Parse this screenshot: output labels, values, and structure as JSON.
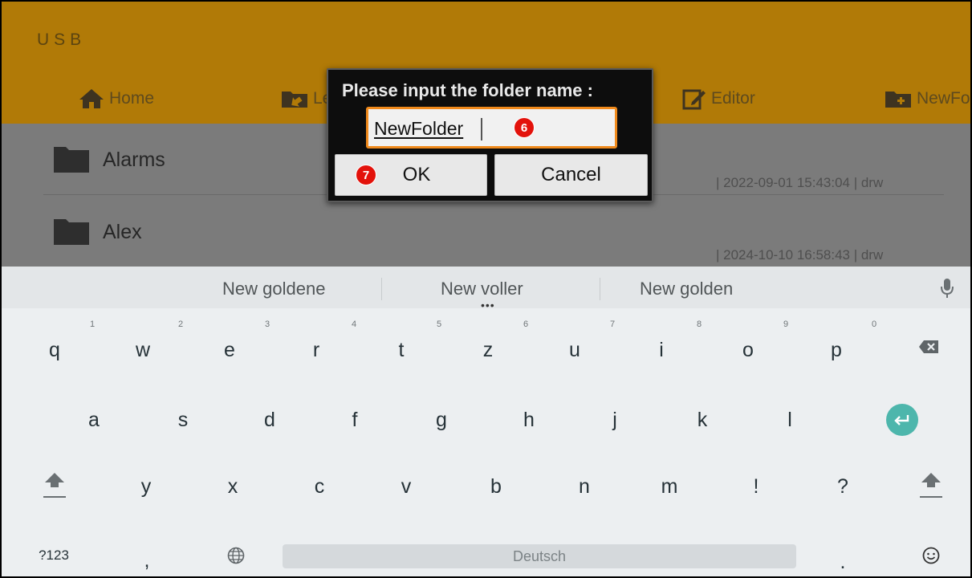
{
  "app": {
    "title": "USB",
    "toolbar": [
      {
        "label": "Home",
        "icon": "home-icon"
      },
      {
        "label": "Le",
        "icon": "folder-up-icon"
      },
      {
        "label": "Editor",
        "icon": "edit-icon"
      },
      {
        "label": "NewFo",
        "icon": "new-folder-icon"
      }
    ],
    "files": [
      {
        "name": "Alarms",
        "meta": "| 2022-09-01 15:43:04 | drw"
      },
      {
        "name": "Alex",
        "meta": "| 2024-10-10 16:58:43 | drw"
      }
    ],
    "colors": {
      "appbar": "#b17a07",
      "accent_orange": "#f08a1c",
      "enter": "#4db6ac",
      "badge": "#e3120b"
    }
  },
  "dialog": {
    "title": "Please input the folder name :",
    "input_value": "NewFolder",
    "ok_label": "OK",
    "cancel_label": "Cancel",
    "badge_input": "6",
    "badge_ok": "7"
  },
  "keyboard": {
    "suggestions": [
      "New goldene",
      "New voller",
      "New golden"
    ],
    "more_indicator": "•••",
    "row1": [
      {
        "key": "q",
        "hint": "1"
      },
      {
        "key": "w",
        "hint": "2"
      },
      {
        "key": "e",
        "hint": "3"
      },
      {
        "key": "r",
        "hint": "4"
      },
      {
        "key": "t",
        "hint": "5"
      },
      {
        "key": "z",
        "hint": "6"
      },
      {
        "key": "u",
        "hint": "7"
      },
      {
        "key": "i",
        "hint": "8"
      },
      {
        "key": "o",
        "hint": "9"
      },
      {
        "key": "p",
        "hint": "0"
      }
    ],
    "row2": [
      "a",
      "s",
      "d",
      "f",
      "g",
      "h",
      "j",
      "k",
      "l"
    ],
    "row3": [
      "y",
      "x",
      "c",
      "v",
      "b",
      "n",
      "m",
      "!",
      "?"
    ],
    "symbols_label": "?123",
    "comma": ",",
    "period": ".",
    "space_label": "Deutsch",
    "icons": [
      "mic-icon",
      "backspace-icon",
      "enter-icon",
      "shift-icon",
      "globe-icon",
      "emoji-icon"
    ]
  }
}
